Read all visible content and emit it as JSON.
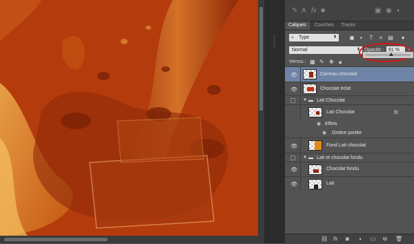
{
  "panel": {
    "tabs": [
      "Calques",
      "Couches",
      "Tracés"
    ],
    "filter": {
      "label": "Type"
    },
    "blend_mode": "Normal",
    "opacity": {
      "label": "Opacité :",
      "value": "61 %"
    },
    "lock": {
      "label": "Verrou :"
    },
    "layers": [
      {
        "name": "Carreau chocolat",
        "selected": true
      },
      {
        "name": "Chocolat éclat"
      },
      {
        "name": "Lait Chocolat",
        "group": true
      },
      {
        "name": "Lait Chocolat",
        "fx": "fx"
      },
      {
        "name": "Effets"
      },
      {
        "name": "Ombre portée"
      },
      {
        "name": "Fond Lait chocolat"
      },
      {
        "name": "Lait et chocolat fondu",
        "group": true
      },
      {
        "name": "Chocolat fondu"
      },
      {
        "name": "Lait"
      }
    ]
  },
  "colors": {
    "accent_selected": "#6f83a6",
    "highlight_circle": "#e01010",
    "canvas_bg": "#b2380a"
  },
  "icons": [
    "eye-icon",
    "folder-icon",
    "fx-icon",
    "link-icon",
    "mask-icon",
    "adjustment-icon",
    "new-group-icon",
    "new-layer-icon",
    "trash-icon",
    "lock-icon",
    "brush-icon",
    "move-icon"
  ]
}
